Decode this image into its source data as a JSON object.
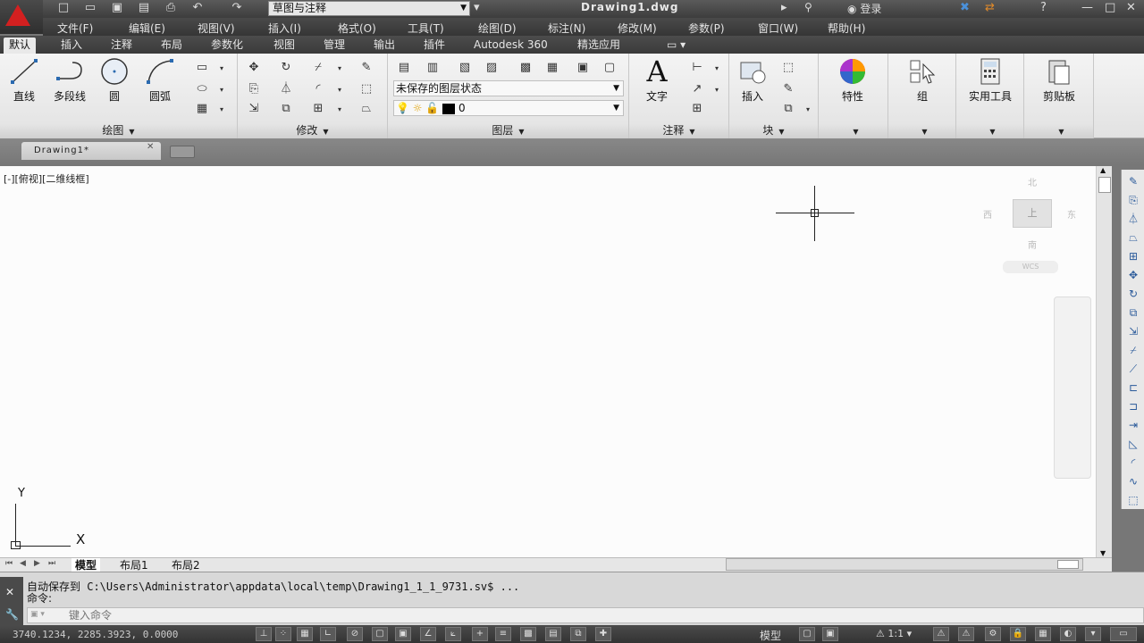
{
  "app": {
    "workspace": "草图与注释",
    "doc_title": "Drawing1.dwg",
    "signin": "登录"
  },
  "menu": [
    "文件(F)",
    "编辑(E)",
    "视图(V)",
    "插入(I)",
    "格式(O)",
    "工具(T)",
    "绘图(D)",
    "标注(N)",
    "修改(M)",
    "参数(P)",
    "窗口(W)",
    "帮助(H)"
  ],
  "tabs": [
    "默认",
    "插入",
    "注释",
    "布局",
    "参数化",
    "视图",
    "管理",
    "输出",
    "插件",
    "Autodesk 360",
    "精选应用"
  ],
  "ribbon": {
    "draw": {
      "title": "绘图",
      "line": "直线",
      "polyline": "多段线",
      "circle": "圆",
      "arc": "圆弧"
    },
    "modify": {
      "title": "修改"
    },
    "layers": {
      "title": "图层",
      "state": "未保存的图层状态",
      "current": "0"
    },
    "annotation": {
      "title": "注释",
      "text": "文字"
    },
    "block": {
      "title": "块",
      "insert": "插入"
    },
    "properties": {
      "label": "特性"
    },
    "groups": {
      "label": "组"
    },
    "utilities": {
      "label": "实用工具"
    },
    "clipboard": {
      "label": "剪贴板"
    }
  },
  "doc_tab": "Drawing1*",
  "viewport_label": "[-][俯视][二维线框]",
  "navcube": {
    "top": "上",
    "north": "北",
    "south": "南",
    "west": "西",
    "east": "东",
    "wcs": "WCS"
  },
  "ucs": {
    "x": "X",
    "y": "Y"
  },
  "layout_tabs": [
    "模型",
    "布局1",
    "布局2"
  ],
  "command": {
    "history": "自动保存到 C:\\Users\\Administrator\\appdata\\local\\temp\\Drawing1_1_1_9731.sv$ ...",
    "prompt": "命令:",
    "input_placeholder": "键入命令"
  },
  "status": {
    "coords": "3740.1234, 2285.3923, 0.0000",
    "model": "模型",
    "scale": "1:1"
  }
}
